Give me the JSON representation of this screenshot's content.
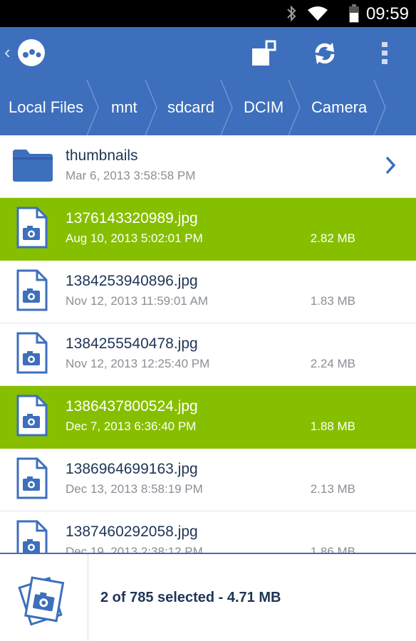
{
  "status_bar": {
    "time": "09:59"
  },
  "breadcrumb": [
    {
      "label": "Local Files"
    },
    {
      "label": "mnt"
    },
    {
      "label": "sdcard"
    },
    {
      "label": "DCIM"
    },
    {
      "label": "Camera"
    }
  ],
  "folder": {
    "name": "thumbnails",
    "date": "Mar 6, 2013 3:58:58 PM"
  },
  "files": [
    {
      "name": "1376143320989.jpg",
      "date": "Aug 10, 2013 5:02:01 PM",
      "size": "2.82 MB",
      "selected": true
    },
    {
      "name": "1384253940896.jpg",
      "date": "Nov 12, 2013 11:59:01 AM",
      "size": "1.83 MB",
      "selected": false
    },
    {
      "name": "1384255540478.jpg",
      "date": "Nov 12, 2013 12:25:40 PM",
      "size": "2.24 MB",
      "selected": false
    },
    {
      "name": "1386437800524.jpg",
      "date": "Dec 7, 2013 6:36:40 PM",
      "size": "1.88 MB",
      "selected": true
    },
    {
      "name": "1386964699163.jpg",
      "date": "Dec 13, 2013 8:58:19 PM",
      "size": "2.13 MB",
      "selected": false
    },
    {
      "name": "1387460292058.jpg",
      "date": "Dec 19, 2013 2:38:12 PM",
      "size": "1.86 MB",
      "selected": false
    }
  ],
  "footer": {
    "summary": "2 of 785 selected - 4.71 MB"
  },
  "colors": {
    "brand_blue": "#3d6fbc",
    "selection_green": "#86bf00",
    "text_dark": "#1e3556",
    "text_muted": "#8a8f96"
  },
  "icons": [
    "bluetooth-icon",
    "wifi-icon",
    "battery-icon",
    "back-icon",
    "app-logo-icon",
    "multi-window-icon",
    "sync-icon",
    "overflow-menu-icon",
    "folder-icon",
    "chevron-right-icon",
    "image-file-icon",
    "selected-files-icon"
  ]
}
